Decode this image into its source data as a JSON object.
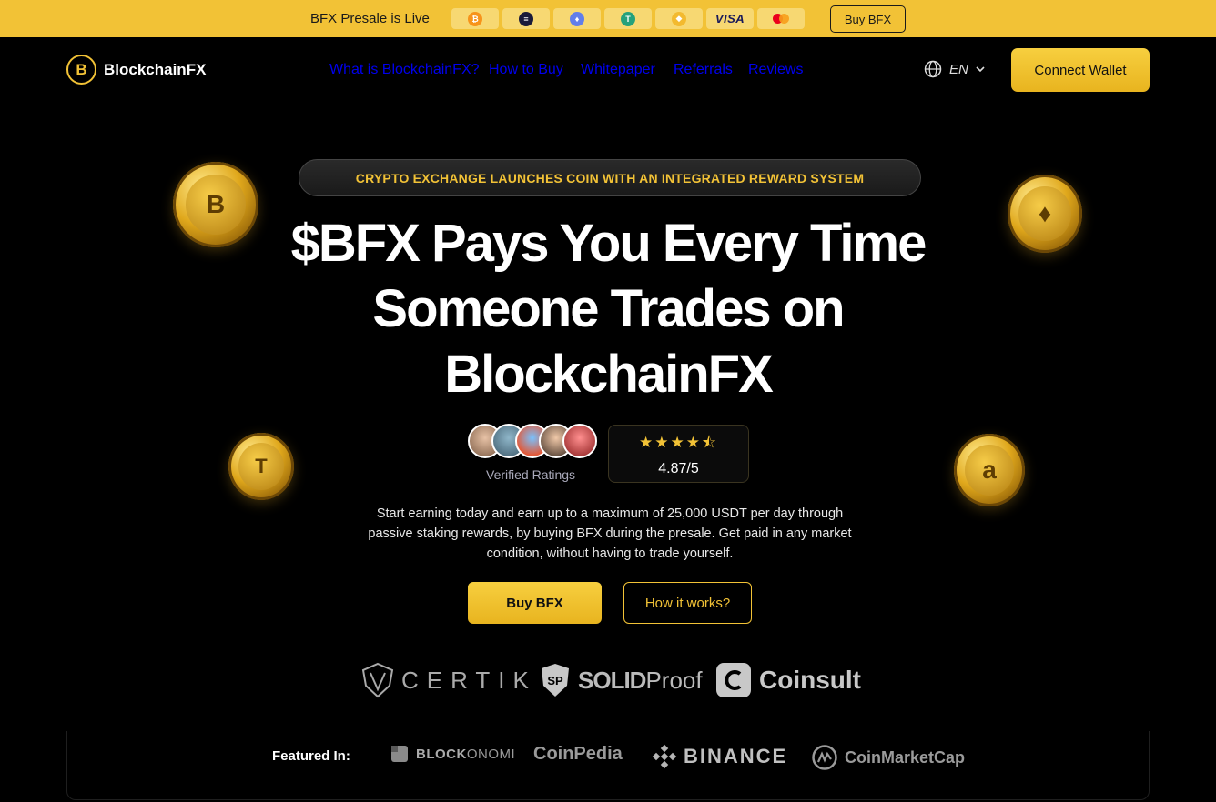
{
  "banner": {
    "text": "BFX Presale is Live",
    "payments": [
      {
        "icon": "bitcoin-icon",
        "color": "#f7931a",
        "glyph": "₿"
      },
      {
        "icon": "solana-icon",
        "color": "#1b1b3a",
        "glyph": "≡"
      },
      {
        "icon": "ethereum-icon",
        "color": "#627eea",
        "glyph": "♦"
      },
      {
        "icon": "tether-icon",
        "color": "#26a17b",
        "glyph": "T"
      },
      {
        "icon": "bnb-icon",
        "color": "#f3ba2f",
        "glyph": "◆"
      },
      {
        "icon": "visa-icon",
        "label": "VISA"
      },
      {
        "icon": "mastercard-icon"
      }
    ],
    "buy_label": "Buy BFX"
  },
  "nav": {
    "brand": "BlockchainFX",
    "brand_mark": "B",
    "links": [
      "What is BlockchainFX?",
      "How to Buy",
      "Whitepaper",
      "Referrals",
      "Reviews"
    ],
    "language": "EN",
    "connect_label": "Connect Wallet"
  },
  "hero": {
    "pill": "CRYPTO EXCHANGE LAUNCHES COIN WITH AN INTEGRATED REWARD SYSTEM",
    "headline_1": "$BFX Pays You Every Time",
    "headline_2": "Someone Trades on",
    "headline_3": "BlockchainFX",
    "verified": "Verified Ratings",
    "stars": "★★★★⯪",
    "rating": "4.87/5",
    "description": "Start earning today and earn up to a maximum of 25,000 USDT per day through passive staking rewards, by buying BFX during the presale. Get paid in any market condition, without having to trade yourself.",
    "buy_label": "Buy BFX",
    "how_label": "How it works?"
  },
  "coins": [
    {
      "icon": "bfx-coin-icon",
      "glyph": "B"
    },
    {
      "icon": "ethereum-coin-icon",
      "glyph": "♦"
    },
    {
      "icon": "tesla-coin-icon",
      "glyph": "T"
    },
    {
      "icon": "amazon-coin-icon",
      "glyph": "a"
    }
  ],
  "audits": {
    "certik": "CERTIK",
    "solidproof_bold": "SOLID",
    "solidproof_light": "Proof",
    "coinsult": "Coinsult"
  },
  "featured": {
    "label": "Featured In:",
    "blockonomi_bold": "BLOCK",
    "blockonomi_light": "ONOMI",
    "coinpedia": "CoinPedia",
    "binance": "BINANCE",
    "coinmarketcap": "CoinMarketCap"
  }
}
